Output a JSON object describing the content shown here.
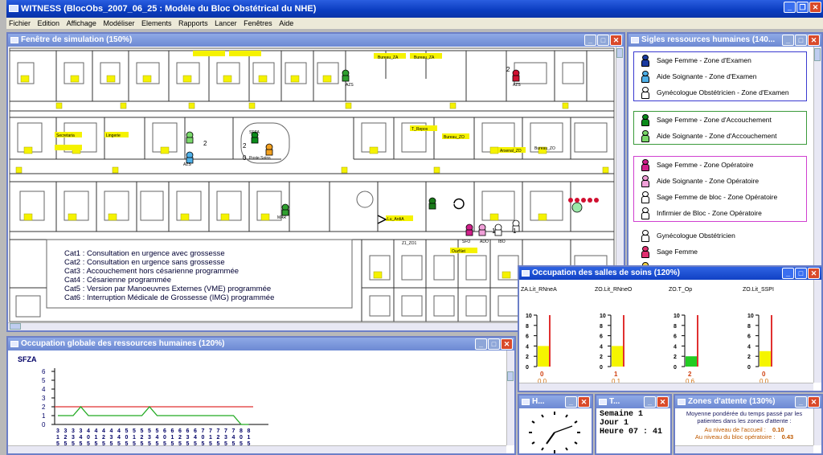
{
  "app": {
    "title": "WITNESS (BlocObs_2007_06_25 : Modèle du Bloc Obstétrical du NHE)",
    "menu": [
      "Fichier",
      "Edition",
      "Affichage",
      "Modéliser",
      "Elements",
      "Rapports",
      "Lancer",
      "Fenêtres",
      "Aide"
    ]
  },
  "simulation": {
    "title": "Fenêtre de simulation (150%)",
    "legend": [
      "Cat1 : Consultation en urgence avec grossesse",
      "Cat2 : Consultation en urgence sans grossesse",
      "Cat3 : Accouchement hors césarienne programmée",
      "Cat4 : Césarienne programmée",
      "Cat5 : Version par Manoeuvres Externes (VME) programmée",
      "Cat6 : Interruption Médicale de Grossesse (IMG) programmée"
    ],
    "labels": {
      "bureau_za": "Bureau_ZA",
      "bureau_za2": "Bureau_ZA",
      "secret": "Secretaria",
      "lingerie": "Lingerie",
      "bureau_zo": "Bureau_ZO",
      "sfza": "SFZA",
      "azs": "AZS",
      "poste": "Poste Soins",
      "t_repos": "T_Repos",
      "bureau_zo2": "Bureau_ZO",
      "arsenal": "Arsenal_ZO",
      "lu": "Lu_ArdiA",
      "z1": "Z1_ZO1",
      "count1": "2",
      "count2": "2",
      "count3": "0",
      "count4": "2",
      "count5": "1",
      "count6": "1",
      "ouz": "OuzNet",
      "lbl_mar": "MAR",
      "lbl_sfo": "SFO",
      "lbl_ado": "ADO",
      "lbl_ibo": "IBO",
      "lbl_a": "AZS",
      "lbl_b": "AZS",
      "lbl_c": "AZS"
    }
  },
  "resources": {
    "title": "Sigles ressources humaines (140...",
    "groups": [
      {
        "items": [
          {
            "label": "Sage Femme - Zone d'Examen",
            "color": "#1a3aa0"
          },
          {
            "label": "Aide Soignante - Zone d'Examen",
            "color": "#4fb0e8"
          },
          {
            "label": "Gynécologue Obstétricien - Zone d'Examen",
            "color": "#ffffff"
          }
        ]
      },
      {
        "items": [
          {
            "label": "Sage Femme - Zone d'Accouchement",
            "color": "#0a8a1a"
          },
          {
            "label": "Aide Soignante - Zone d'Accouchement",
            "color": "#7ad86a"
          }
        ]
      },
      {
        "items": [
          {
            "label": "Sage Femme - Zone Opératoire",
            "color": "#d0208a"
          },
          {
            "label": "Aide Soignante - Zone Opératoire",
            "color": "#f0a0d8"
          },
          {
            "label": "Sage Femme de bloc - Zone Opératoire",
            "color": "#ffffff"
          },
          {
            "label": "Infirmier de Bloc - Zone Opératoire",
            "color": "#ffffff"
          }
        ]
      },
      {
        "items": [
          {
            "label": "Gynécologue Obstétricien",
            "color": "#ffffff"
          },
          {
            "label": "Sage Femme",
            "color": "#e03070"
          },
          {
            "label": "Aide Soignante",
            "color": "#f2d040"
          }
        ]
      }
    ]
  },
  "occupation_rh": {
    "title": "Occupation globale des ressources humaines (120%)",
    "series_label": "SFZA",
    "chart_data": {
      "type": "line",
      "series_name": "SFZA",
      "yticks": [
        "0",
        "1",
        "2",
        "3",
        "4",
        "5",
        "6"
      ],
      "ylim": [
        0,
        6
      ],
      "limit_line": 2,
      "x": [
        "3 1 5",
        "3 2 5",
        "3 3 5",
        "3 4 5",
        "4 0 5",
        "4 1 5",
        "4 2 5",
        "4 3 5",
        "4 4 5",
        "5 0 5",
        "5 1 5",
        "5 2 5",
        "5 3 5",
        "5 4 5",
        "6 0 5",
        "6 1 5",
        "6 2 5",
        "6 3 5",
        "6 4 5",
        "7 0 5",
        "7 1 5",
        "7 2 5",
        "7 3 5",
        "7 4 5",
        "8 0 5",
        "8 1 5"
      ],
      "values": [
        1,
        1,
        1,
        2,
        1,
        1,
        1,
        1,
        1,
        1,
        1,
        1,
        2,
        1,
        1,
        1,
        1,
        1,
        1,
        1,
        1,
        1,
        1,
        1,
        0,
        0
      ]
    }
  },
  "occupation_salles": {
    "title": "Occupation des salles de soins (120%)",
    "chart_data": {
      "type": "bar",
      "categories": [
        "ZA.Lit_RNneA",
        "ZO.Lit_RNneO",
        "ZO.T_Op",
        "ZO.Lit_SSPI"
      ],
      "yticks": [
        "0",
        "2",
        "4",
        "6",
        "8",
        "10"
      ],
      "ylim": [
        0,
        10
      ],
      "values": [
        4,
        4,
        2,
        3
      ],
      "colors": [
        "#f5f500",
        "#f5f500",
        "#22cc22",
        "#f5f500"
      ],
      "counts": [
        "0",
        "1",
        "2",
        "0"
      ],
      "ratios": [
        "0.0",
        "0.1",
        "0.6",
        "0.0"
      ]
    }
  },
  "horloge": {
    "title": "H..."
  },
  "temps": {
    "title": "T...",
    "week": "Semaine 1",
    "day": "Jour 1",
    "hour": "Heure 07 : 41"
  },
  "attente": {
    "title": "Zones d'attente (130%)",
    "heading": "Moyenne pondérée du temps passé par les patientes dans les zones d'attente :",
    "rows": [
      {
        "label": "Au niveau de l'accueil :",
        "value": "0.10"
      },
      {
        "label": "Au niveau du bloc opératoire :",
        "value": "0.43"
      }
    ]
  }
}
